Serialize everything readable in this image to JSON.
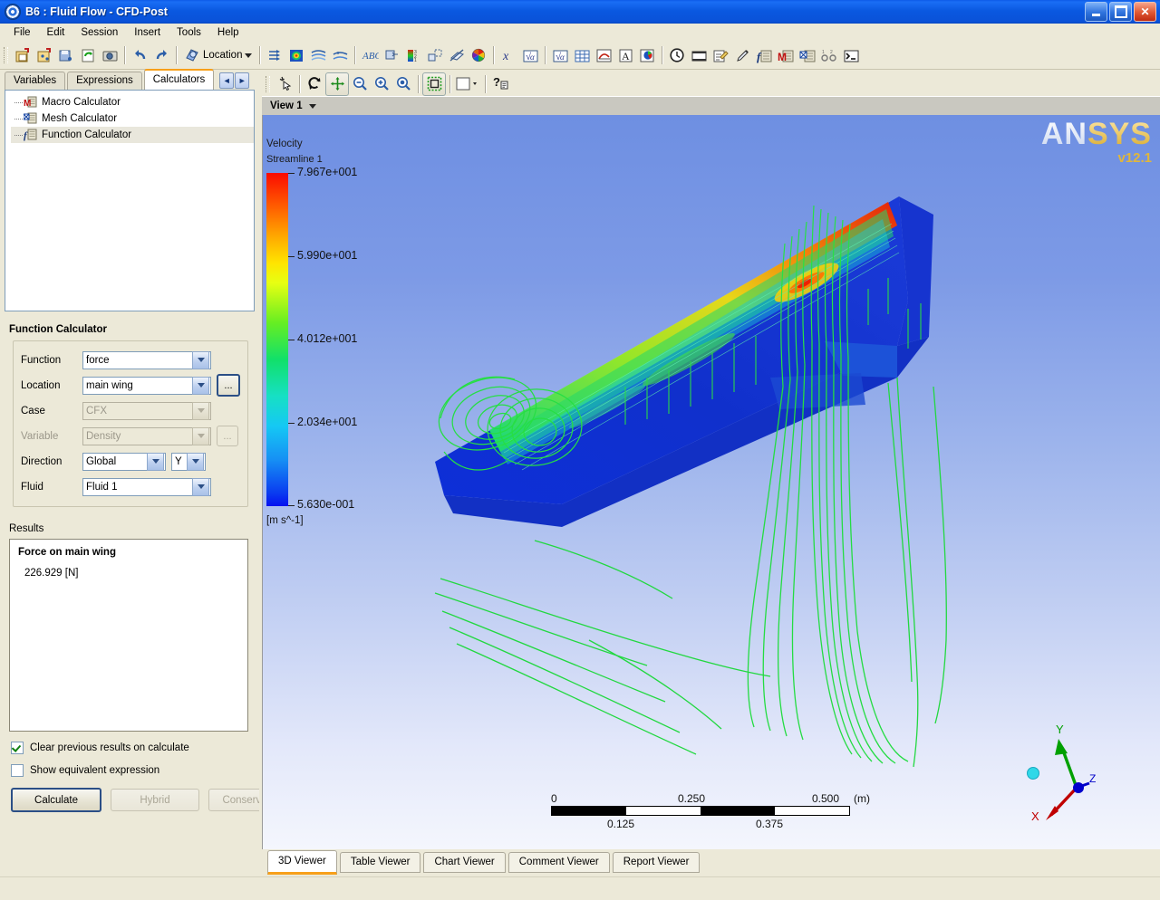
{
  "window": {
    "title": "B6 : Fluid Flow - CFD-Post",
    "app_icon": "eye-icon",
    "minimize_label": "Minimize",
    "maximize_label": "Maximize",
    "close_label": "Close"
  },
  "menu": {
    "items": [
      "File",
      "Edit",
      "Session",
      "Insert",
      "Tools",
      "Help"
    ]
  },
  "toolbar": {
    "groups": [
      {
        "icons": [
          "new-case-icon",
          "load-results-icon",
          "save-state-icon",
          "refresh-icon",
          "snapshot-icon"
        ]
      },
      {
        "icons": [
          "undo-icon",
          "redo-icon"
        ]
      },
      {
        "icons": [
          "location-icon"
        ],
        "location_label": "Location"
      },
      {
        "icons": [
          "vector-icon",
          "contour-icon",
          "streamline-icon",
          "particle-track-icon"
        ]
      },
      {
        "icons": [
          "text-icon",
          "coordinate-frame-icon",
          "legend-icon",
          "instance-transform-icon",
          "clip-plane-icon",
          "color-map-icon"
        ]
      },
      {
        "icons": [
          "expression-icon",
          "calculator-icon"
        ]
      },
      {
        "icons": [
          "function-calculator-icon",
          "table-icon",
          "chart-icon",
          "comment-icon",
          "report-icon"
        ]
      },
      {
        "icons": [
          "timestep-selector-icon",
          "animation-icon",
          "edit-macro-icon",
          "probe-icon",
          "function-calc-icon",
          "macro-calc-icon",
          "mesh-calc-icon",
          "mesh-compare-icon",
          "command-editor-icon"
        ]
      }
    ]
  },
  "sidebar": {
    "tabs": [
      {
        "label": "Variables",
        "active": false
      },
      {
        "label": "Expressions",
        "active": false
      },
      {
        "label": "Calculators",
        "active": true
      }
    ],
    "tab_nav": {
      "prev": "◄",
      "next": "►"
    },
    "tree": [
      {
        "label": "Macro Calculator",
        "icon": "macro-calculator-icon",
        "selected": false
      },
      {
        "label": "Mesh Calculator",
        "icon": "mesh-calculator-icon",
        "selected": false
      },
      {
        "label": "Function Calculator",
        "icon": "function-calculator-icon",
        "selected": true
      }
    ]
  },
  "function_calculator": {
    "title": "Function Calculator",
    "fields": [
      {
        "label": "Function",
        "value": "force",
        "enabled": true,
        "browse": false
      },
      {
        "label": "Location",
        "value": "main wing",
        "enabled": true,
        "browse": true
      },
      {
        "label": "Case",
        "value": "CFX",
        "enabled": false,
        "browse": false
      },
      {
        "label": "Variable",
        "value": "Density",
        "enabled": false,
        "browse": true
      },
      {
        "label": "Direction",
        "value": "Global",
        "value2": "Y",
        "enabled": true,
        "browse": false
      },
      {
        "label": "Fluid",
        "value": "Fluid 1",
        "enabled": true,
        "browse": false
      }
    ],
    "browse_label": "...",
    "results_label": "Results",
    "result_heading": "Force on main wing",
    "result_value": "226.929 [N]",
    "checkboxes": [
      {
        "label": "Clear previous results on calculate",
        "checked": true
      },
      {
        "label": "Show equivalent expression",
        "checked": false
      }
    ],
    "buttons": [
      {
        "label": "Calculate",
        "enabled": true,
        "primary": true
      },
      {
        "label": "Hybrid",
        "enabled": false,
        "primary": false
      },
      {
        "label": "Conservative",
        "enabled": false,
        "primary": false
      }
    ]
  },
  "viewer_toolbar": {
    "icons": [
      "select-pointer-icon",
      "rotate-icon",
      "pan-icon",
      "zoom-out-icon",
      "zoom-in-icon",
      "zoom-fit-icon",
      "bounding-box-icon",
      "background-color-icon",
      "chevron-down-icon",
      "help-pointer-icon"
    ]
  },
  "view_tab": {
    "label": "View 1",
    "dropdown": "chevron-down-icon"
  },
  "viewport": {
    "logo": {
      "part1": "AN",
      "part2": "SYS",
      "version": "v12.1"
    },
    "legend": {
      "title": "Velocity",
      "subtitle": "Streamline 1",
      "unit": "[m s^-1]",
      "ticks": [
        {
          "value": "7.967e+001",
          "pos": 0
        },
        {
          "value": "5.990e+001",
          "pos": 0.25
        },
        {
          "value": "4.012e+001",
          "pos": 0.5
        },
        {
          "value": "2.034e+001",
          "pos": 0.75
        },
        {
          "value": "5.630e-001",
          "pos": 1
        }
      ]
    },
    "scale_bar": {
      "top_labels": [
        "0",
        "0.250",
        "0.500"
      ],
      "unit": "(m)",
      "bottom_labels": [
        "0.125",
        "0.375"
      ]
    },
    "axis_triad": {
      "x": "X",
      "y": "Y",
      "z": "Z"
    }
  },
  "viewer_tabs": [
    {
      "label": "3D Viewer",
      "active": true
    },
    {
      "label": "Table Viewer",
      "active": false
    },
    {
      "label": "Chart Viewer",
      "active": false
    },
    {
      "label": "Comment Viewer",
      "active": false
    },
    {
      "label": "Report Viewer",
      "active": false
    }
  ]
}
